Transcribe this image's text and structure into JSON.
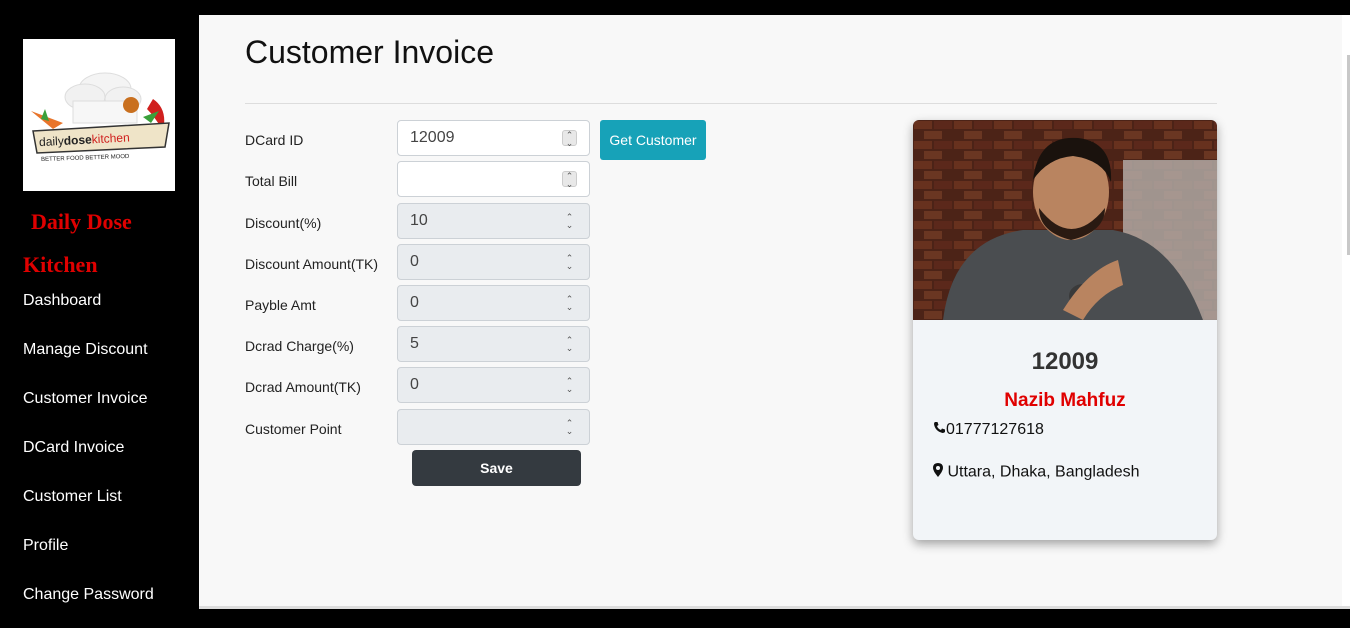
{
  "brand": {
    "line1": "Daily Dose",
    "line2": "Kitchen",
    "logo_text": "dailydosekitchen",
    "logo_tagline": "BETTER FOOD BETTER MOOD"
  },
  "nav": {
    "items": [
      {
        "label": "Dashboard"
      },
      {
        "label": "Manage Discount"
      },
      {
        "label": "Customer Invoice"
      },
      {
        "label": "DCard Invoice"
      },
      {
        "label": "Customer List"
      },
      {
        "label": "Profile"
      },
      {
        "label": "Change Password"
      }
    ]
  },
  "page": {
    "title": "Customer Invoice"
  },
  "form": {
    "dcard_id": {
      "label": "DCard ID",
      "value": "12009"
    },
    "total_bill": {
      "label": "Total Bill",
      "value": ""
    },
    "discount": {
      "label": "Discount(%)",
      "value": "10"
    },
    "discount_amount": {
      "label": "Discount Amount(TK)",
      "value": "0"
    },
    "payable": {
      "label": "Payble Amt",
      "value": "0"
    },
    "dcard_charge": {
      "label": "Dcrad Charge(%)",
      "value": "5"
    },
    "dcard_amount": {
      "label": "Dcrad Amount(TK)",
      "value": "0"
    },
    "customer_point": {
      "label": "Customer Point",
      "value": ""
    },
    "get_customer_label": "Get Customer",
    "save_label": "Save"
  },
  "customer_card": {
    "id": "12009",
    "name": "Nazib Mahfuz",
    "phone": "01777127618",
    "address": "Uttara, Dhaka, Bangladesh"
  },
  "colors": {
    "accent_teal": "#17a2b8",
    "brand_red": "#e00000",
    "dark_button": "#343a40"
  },
  "icons": {
    "phone": "phone-icon",
    "location": "map-marker-icon",
    "spinner": "chevron-up-down-icon"
  }
}
